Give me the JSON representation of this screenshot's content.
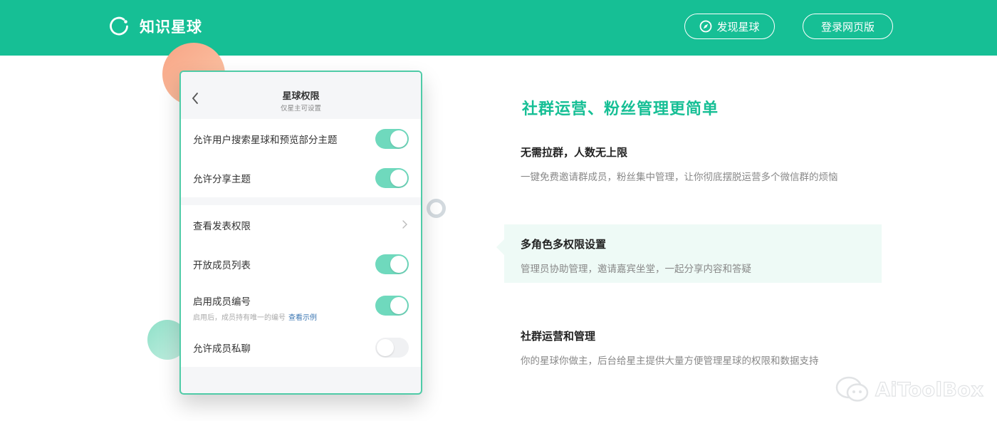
{
  "header": {
    "brand": "知识星球",
    "discover_label": "发现星球",
    "login_label": "登录网页版",
    "bg_color": "#16bf95"
  },
  "card": {
    "title": "星球权限",
    "subtitle": "仅星主可设置",
    "group1": [
      {
        "label": "允许用户搜索星球和预览部分主题",
        "toggle": "on"
      },
      {
        "label": "允许分享主题",
        "toggle": "on"
      }
    ],
    "group2": {
      "link_row": {
        "label": "查看发表权限"
      },
      "member_list": {
        "label": "开放成员列表",
        "toggle": "on"
      },
      "member_number": {
        "label": "启用成员编号",
        "hint": "启用后，成员持有唯一的编号",
        "hint_link": "查看示例",
        "toggle": "on"
      },
      "private_chat": {
        "label": "允许成员私聊",
        "toggle": "off"
      }
    }
  },
  "content": {
    "headline": "社群运营、粉丝管理更简单",
    "features": [
      {
        "title": "无需拉群，人数无上限",
        "desc": "一键免费邀请群成员，粉丝集中管理，让你彻底摆脱运营多个微信群的烦恼"
      },
      {
        "title": "多角色多权限设置",
        "desc": "管理员协助管理，邀请嘉宾坐堂，一起分享内容和答疑"
      },
      {
        "title": "社群运营和管理",
        "desc": "你的星球你做主，后台给星主提供大量方便管理星球的权限和数据支持"
      }
    ]
  },
  "watermark": {
    "text": "AiToolBox"
  },
  "icons": {
    "logo": "planet-ring-icon",
    "discover": "compass-icon",
    "back": "chevron-left-icon",
    "link": "chevron-right-icon",
    "watermark": "wechat-icon"
  },
  "colors": {
    "accent": "#16bf95",
    "toggle_on": "#6fd9bd",
    "link": "#3c77b3",
    "feature_bg": "#eefaf6"
  }
}
